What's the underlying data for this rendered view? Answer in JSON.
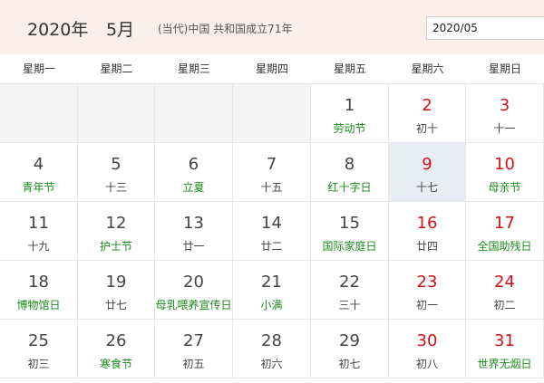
{
  "header": {
    "year": "2020年",
    "month": "5月",
    "info": "(当代)中国 共和国成立71年",
    "input_value": "2020/05"
  },
  "weekdays": [
    "星期一",
    "星期二",
    "星期三",
    "星期四",
    "星期五",
    "星期六",
    "星期日"
  ],
  "weeks": [
    [
      {
        "empty": true
      },
      {
        "empty": true
      },
      {
        "empty": true
      },
      {
        "empty": true
      },
      {
        "day": "1",
        "sub": "劳动节",
        "weekend": false,
        "festival": true
      },
      {
        "day": "2",
        "sub": "初十",
        "weekend": true,
        "festival": false
      },
      {
        "day": "3",
        "sub": "十一",
        "weekend": true,
        "festival": false
      }
    ],
    [
      {
        "day": "4",
        "sub": "青年节",
        "weekend": false,
        "festival": true
      },
      {
        "day": "5",
        "sub": "十三",
        "weekend": false,
        "festival": false
      },
      {
        "day": "6",
        "sub": "立夏",
        "weekend": false,
        "festival": true
      },
      {
        "day": "7",
        "sub": "十五",
        "weekend": false,
        "festival": false
      },
      {
        "day": "8",
        "sub": "红十字日",
        "weekend": false,
        "festival": true
      },
      {
        "day": "9",
        "sub": "十七",
        "weekend": true,
        "festival": false,
        "selected": true
      },
      {
        "day": "10",
        "sub": "母亲节",
        "weekend": true,
        "festival": true
      }
    ],
    [
      {
        "day": "11",
        "sub": "十九",
        "weekend": false,
        "festival": false
      },
      {
        "day": "12",
        "sub": "护士节",
        "weekend": false,
        "festival": true
      },
      {
        "day": "13",
        "sub": "廿一",
        "weekend": false,
        "festival": false
      },
      {
        "day": "14",
        "sub": "廿二",
        "weekend": false,
        "festival": false
      },
      {
        "day": "15",
        "sub": "国际家庭日",
        "weekend": false,
        "festival": true
      },
      {
        "day": "16",
        "sub": "廿四",
        "weekend": true,
        "festival": false
      },
      {
        "day": "17",
        "sub": "全国助残日",
        "weekend": true,
        "festival": true
      }
    ],
    [
      {
        "day": "18",
        "sub": "博物馆日",
        "weekend": false,
        "festival": true
      },
      {
        "day": "19",
        "sub": "廿七",
        "weekend": false,
        "festival": false
      },
      {
        "day": "20",
        "sub": "母乳喂养宣传日",
        "weekend": false,
        "festival": true
      },
      {
        "day": "21",
        "sub": "小满",
        "weekend": false,
        "festival": true
      },
      {
        "day": "22",
        "sub": "三十",
        "weekend": false,
        "festival": false
      },
      {
        "day": "23",
        "sub": "初一",
        "weekend": true,
        "festival": false
      },
      {
        "day": "24",
        "sub": "初二",
        "weekend": true,
        "festival": false
      }
    ],
    [
      {
        "day": "25",
        "sub": "初三",
        "weekend": false,
        "festival": false
      },
      {
        "day": "26",
        "sub": "寒食节",
        "weekend": false,
        "festival": true
      },
      {
        "day": "27",
        "sub": "初五",
        "weekend": false,
        "festival": false
      },
      {
        "day": "28",
        "sub": "初六",
        "weekend": false,
        "festival": false
      },
      {
        "day": "29",
        "sub": "初七",
        "weekend": false,
        "festival": false
      },
      {
        "day": "30",
        "sub": "初八",
        "weekend": true,
        "festival": false
      },
      {
        "day": "31",
        "sub": "世界无烟日",
        "weekend": true,
        "festival": true
      }
    ]
  ],
  "colors": {
    "weekend_number": "#d0121a",
    "festival_text": "#1b8c1b",
    "header_bg": "#fbeeeb",
    "selected_bg": "#e8edf4"
  }
}
